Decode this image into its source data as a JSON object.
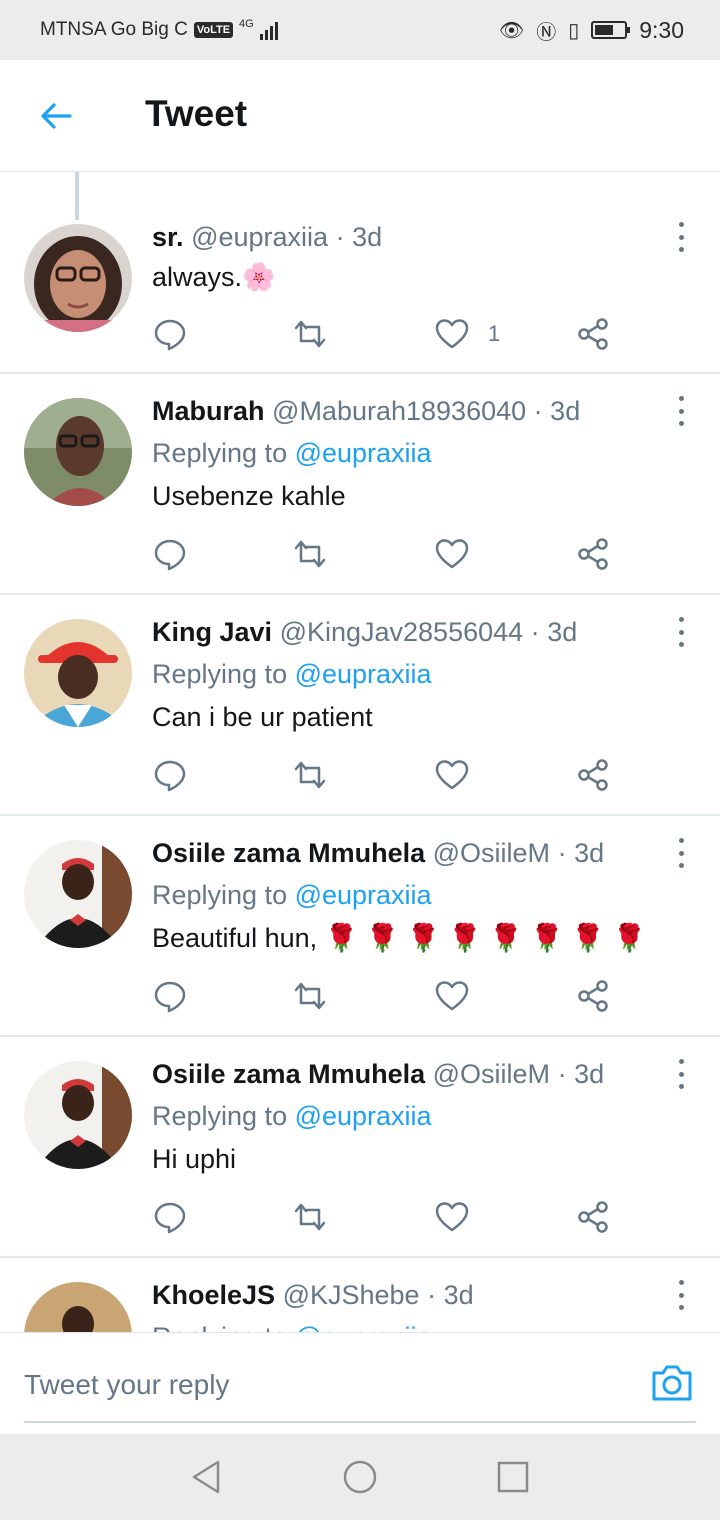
{
  "status_bar": {
    "carrier": "MTNSA Go Big C",
    "volte": "VoLTE",
    "network": "4G",
    "time": "9:30"
  },
  "header": {
    "title": "Tweet"
  },
  "tweets": [
    {
      "name": "sr.",
      "handle": "@eupraxiia",
      "time": "3d",
      "replying_label": "",
      "mention": "",
      "text": "always.🌸",
      "likes": "1"
    },
    {
      "name": "Maburah",
      "handle": "@Maburah18936040",
      "time": "3d",
      "replying_label": "Replying to ",
      "mention": "@eupraxiia",
      "text": "Usebenze kahle",
      "likes": ""
    },
    {
      "name": "King Javi",
      "handle": "@KingJav28556044",
      "time": "3d",
      "replying_label": "Replying to ",
      "mention": "@eupraxiia",
      "text": "Can i be ur patient",
      "likes": ""
    },
    {
      "name": "Osiile zama Mmuhela",
      "handle": "@OsiileM",
      "time": "3d",
      "replying_label": "Replying to ",
      "mention": "@eupraxiia",
      "text": "Beautiful hun, 🌹 🌹 🌹 🌹 🌹 🌹 🌹 🌹",
      "likes": ""
    },
    {
      "name": "Osiile zama Mmuhela",
      "handle": "@OsiileM",
      "time": "3d",
      "replying_label": "Replying to ",
      "mention": "@eupraxiia",
      "text": "Hi uphi",
      "likes": ""
    },
    {
      "name": "KhoeleJS",
      "handle": "@KJShebe",
      "time": "3d",
      "replying_label": "Replying to ",
      "mention": "@eupraxiia",
      "text": "",
      "likes": ""
    }
  ],
  "reply_bar": {
    "placeholder": "Tweet your reply"
  },
  "icons": {
    "back": "arrow-left-icon",
    "reply": "comment-icon",
    "retweet": "retweet-icon",
    "like": "heart-icon",
    "share": "share-icon",
    "more": "more-vertical-icon",
    "camera": "camera-icon"
  },
  "colors": {
    "accent": "#1da1f2",
    "muted": "#657786",
    "text": "#14171a",
    "border": "#e1e8ed"
  }
}
